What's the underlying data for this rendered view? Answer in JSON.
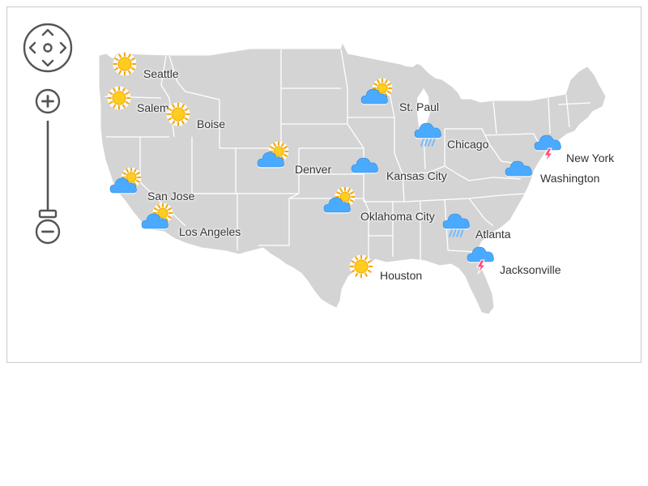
{
  "map": {
    "land_color": "#d4d4d4",
    "border_color": "#ffffff",
    "frame_border_color": "#cccccc",
    "control_color": "#555555",
    "zoom_level": 1.0
  },
  "controls": {
    "pan_icon": "pan-arrows-icon",
    "zoom_in_icon": "plus-icon",
    "zoom_out_icon": "minus-icon"
  },
  "legend_icons": {
    "sunny": "sun-icon",
    "partly_cloudy": "partly-cloudy-icon",
    "cloudy": "cloud-icon",
    "rain": "rain-cloud-icon",
    "thunderstorm": "thunder-cloud-icon"
  },
  "colors": {
    "sun": "#ffcc1f",
    "sun_ray": "#f5a800",
    "cloud": "#49aaff",
    "cloud_shadow": "#2f87d8",
    "rain": "#6fb8ff",
    "bolt": "#ff4d7d"
  },
  "cities": [
    {
      "id": "seattle",
      "name": "Seattle",
      "weather": "sunny"
    },
    {
      "id": "salem",
      "name": "Salem",
      "weather": "sunny"
    },
    {
      "id": "boise",
      "name": "Boise",
      "weather": "sunny"
    },
    {
      "id": "st-paul",
      "name": "St. Paul",
      "weather": "partly_cloudy"
    },
    {
      "id": "chicago",
      "name": "Chicago",
      "weather": "rain"
    },
    {
      "id": "new-york",
      "name": "New York",
      "weather": "thunderstorm"
    },
    {
      "id": "denver",
      "name": "Denver",
      "weather": "partly_cloudy"
    },
    {
      "id": "kansas-city",
      "name": "Kansas City",
      "weather": "cloudy"
    },
    {
      "id": "washington",
      "name": "Washington",
      "weather": "cloudy"
    },
    {
      "id": "san-jose",
      "name": "San Jose",
      "weather": "partly_cloudy"
    },
    {
      "id": "oklahoma-city",
      "name": "Oklahoma City",
      "weather": "partly_cloudy"
    },
    {
      "id": "los-angeles",
      "name": "Los Angeles",
      "weather": "partly_cloudy"
    },
    {
      "id": "atlanta",
      "name": "Atlanta",
      "weather": "rain"
    },
    {
      "id": "jacksonville",
      "name": "Jacksonville",
      "weather": "thunderstorm"
    },
    {
      "id": "houston",
      "name": "Houston",
      "weather": "sunny"
    }
  ]
}
